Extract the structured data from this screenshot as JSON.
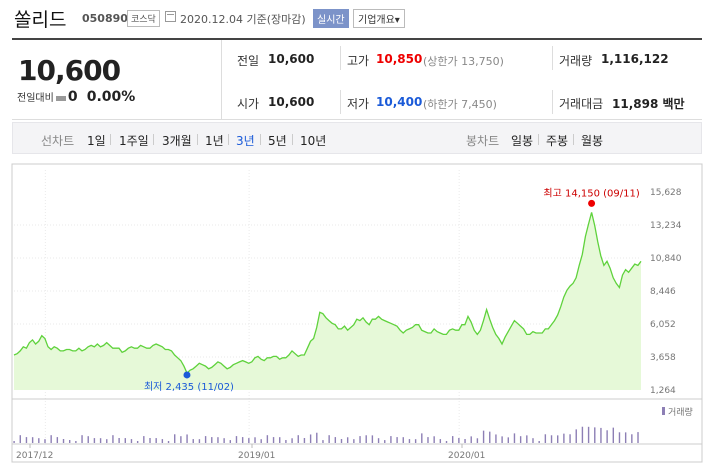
{
  "header": {
    "name": "쏠리드",
    "code": "050890",
    "market": "코스닥",
    "date": "2020.12.04 기준(장마감)",
    "live": "실시간",
    "company_info": "기업개요▾"
  },
  "quote": {
    "price": "10,600",
    "change_label": "전일대비",
    "change_value": "0",
    "change_pct": "0.00%",
    "prev_close_label": "전일",
    "prev_close": "10,600",
    "high_label": "고가",
    "high": "10,850",
    "upper_limit": "(상한가 13,750)",
    "volume_label": "거래량",
    "volume": "1,116,122",
    "open_label": "시가",
    "open": "10,600",
    "low_label": "저가",
    "low": "10,400",
    "lower_limit": "(하한가 7,450)",
    "amount_label": "거래대금",
    "amount": "11,898 백만"
  },
  "periods": {
    "label": "선차트",
    "items": [
      "1일",
      "1주일",
      "3개월",
      "1년",
      "3년",
      "5년",
      "10년"
    ],
    "selected": "3년",
    "candle_label": "봉차트",
    "candle_items": [
      "일봉",
      "주봉",
      "월봉"
    ]
  },
  "colors": {
    "accent": "#1a5ad8",
    "up": "#e00000",
    "line": "#5fd23c",
    "fill": "#e6f9d8"
  },
  "chart_data": {
    "type": "area",
    "y_ticks": [
      "15,628",
      "13,234",
      "10,840",
      "8,446",
      "6,052",
      "3,658",
      "1,264"
    ],
    "ylim": [
      1264,
      15628
    ],
    "x_ticks": [
      "2017/12",
      "2019/01",
      "2020/01"
    ],
    "max_label": "최고 14,150 (09/11)",
    "min_label": "최저 2,435 (11/02)",
    "volume_label": "거래량",
    "values": [
      3800,
      3900,
      4100,
      4400,
      4300,
      4700,
      4900,
      4600,
      4800,
      5200,
      5000,
      4400,
      4200,
      4400,
      4300,
      4100,
      4100,
      4200,
      4200,
      4100,
      4100,
      4300,
      4100,
      4200,
      4400,
      4500,
      4400,
      4600,
      4400,
      4500,
      4700,
      4500,
      4300,
      4300,
      4300,
      4000,
      4100,
      4300,
      4400,
      4300,
      4300,
      4500,
      4400,
      4300,
      4300,
      4500,
      4600,
      4500,
      4400,
      4200,
      4200,
      4100,
      3800,
      3600,
      3400,
      3000,
      2500,
      2700,
      2800,
      3000,
      3200,
      3100,
      3000,
      2800,
      2900,
      3100,
      3300,
      3200,
      3000,
      2800,
      2900,
      3100,
      3200,
      3300,
      3400,
      3300,
      3200,
      3300,
      3600,
      3700,
      3500,
      3400,
      3600,
      3600,
      3700,
      3700,
      3500,
      3600,
      3600,
      3800,
      4100,
      3900,
      3700,
      3800,
      3800,
      4300,
      4800,
      5000,
      5800,
      6900,
      6800,
      6500,
      6300,
      6100,
      6000,
      5700,
      5700,
      5900,
      5600,
      5800,
      6000,
      6400,
      6300,
      6500,
      6200,
      6000,
      6400,
      6400,
      6600,
      6400,
      6300,
      6200,
      6100,
      6000,
      5900,
      5600,
      5400,
      5600,
      5700,
      5800,
      6000,
      6000,
      5600,
      5500,
      5400,
      5400,
      5700,
      5500,
      5400,
      5300,
      5300,
      5600,
      5700,
      5600,
      5600,
      6000,
      6000,
      6600,
      6200,
      5600,
      5300,
      5600,
      6300,
      7100,
      6400,
      5800,
      5300,
      5000,
      4600,
      5100,
      5500,
      5900,
      6300,
      6100,
      5900,
      5700,
      5300,
      5300,
      5500,
      5400,
      5400,
      5400,
      5700,
      5700,
      6000,
      6300,
      6700,
      7300,
      8000,
      8500,
      8800,
      9000,
      9400,
      10300,
      11100,
      12400,
      13300,
      14150,
      13200,
      12000,
      11000,
      10300,
      10600,
      10100,
      9400,
      9000,
      8700,
      9600,
      10000,
      9800,
      10100,
      10400,
      10300,
      10600
    ]
  }
}
